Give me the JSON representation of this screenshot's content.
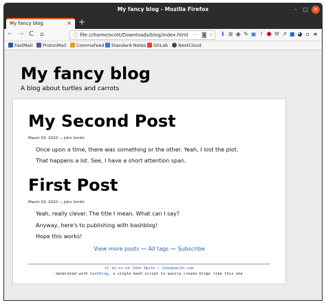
{
  "window": {
    "title": "My fancy blog - Mozilla Firefox",
    "controls": {
      "minimize": "–",
      "maximize": "□",
      "close": "×"
    }
  },
  "tabs": [
    {
      "label": "My fancy blog",
      "close": "×"
    }
  ],
  "new_tab": "+",
  "nav": {
    "back": "←",
    "forward": "→",
    "reload": "C",
    "home": "⌂",
    "url": "file:///home/scott/Downloads/blog/index.html",
    "url_actions": {
      "more": "···",
      "pocket": "◙",
      "bookmark": "☆"
    }
  },
  "toolbar_icons": [
    {
      "name": "download-icon",
      "glyph": "⬇",
      "color": "#2a6fd6"
    },
    {
      "name": "library-icon",
      "glyph": "⊞",
      "color": "#555555"
    },
    {
      "name": "account-icon",
      "glyph": "◉",
      "color": "#555555"
    },
    {
      "name": "extension-pin-icon",
      "glyph": "✎",
      "color": "#333333"
    },
    {
      "name": "extension-box-icon",
      "glyph": "▣",
      "color": "#2a6fd6"
    },
    {
      "name": "extension-info-icon",
      "glyph": "ǃ",
      "color": "#333333"
    },
    {
      "name": "ublock-icon",
      "glyph": "⬟",
      "color": "#b5161c"
    },
    {
      "name": "extension-tool-icon",
      "glyph": "⚒",
      "color": "#555555"
    },
    {
      "name": "extension-arrow-icon",
      "glyph": "↗",
      "color": "#333333"
    },
    {
      "name": "extension-blue-icon",
      "glyph": "■",
      "color": "#1c6fd0"
    },
    {
      "name": "extension-circle-icon",
      "glyph": "◕",
      "color": "#333333"
    },
    {
      "name": "extension-square-icon",
      "glyph": "▫",
      "color": "#333333"
    },
    {
      "name": "menu-icon",
      "glyph": "≡",
      "color": "#333333"
    }
  ],
  "bookmarks": [
    {
      "label": "FastMail",
      "color": "#2a5aa8"
    },
    {
      "label": "ProtonMail",
      "color": "#555a8a"
    },
    {
      "label": "CommaFeed",
      "color": "#f09a1a"
    },
    {
      "label": "Standard Notes",
      "color": "#3a7ad6"
    },
    {
      "label": "GitLab",
      "color": "#e24329"
    },
    {
      "label": "NextCloud",
      "color": "#444444"
    }
  ],
  "site": {
    "title": "My fancy blog",
    "description": "A blog about turtles and carrots"
  },
  "posts": [
    {
      "title": "My Second Post",
      "date": "March 03, 2020",
      "separator": "—",
      "author": "John Smith",
      "paragraphs": [
        "Once upon a time, there was something or the other. Yeah, I lost the plot.",
        "That happens a lot. See, I have a short attention span."
      ]
    },
    {
      "title": "First Post",
      "date": "March 03, 2020",
      "separator": "—",
      "author": "John Smith",
      "paragraphs": [
        "Yeah, really clever. The title I mean. What can I say?",
        "Anyway, here's to publishing with bashblog!",
        "Hope this works!"
      ]
    }
  ],
  "footer": {
    "links": {
      "more": "View more posts",
      "tags": "All tags",
      "subscribe": "Subscribe",
      "sep": "—"
    },
    "license": "CC by-nc-nd",
    "author": "John Smith",
    "email": "john@smith.com",
    "generated_prefix": "Generated with",
    "generator": "bashblog",
    "generated_suffix": ", a single bash script to easily create blogs like this one"
  }
}
